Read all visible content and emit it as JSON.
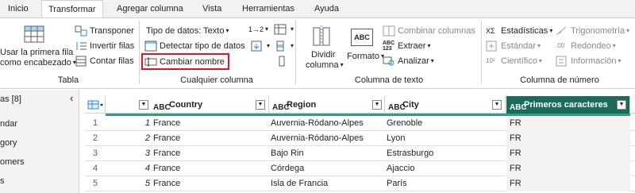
{
  "tabs": [
    "Inicio",
    "Transformar",
    "Agregar columna",
    "Vista",
    "Herramientas",
    "Ayuda"
  ],
  "active_tab": "Transformar",
  "ribbon": {
    "tabla": {
      "label": "Tabla",
      "use_first_row_line1": "Usar la primera fila",
      "use_first_row_line2": "como encabezado",
      "transpose": "Transponer",
      "reverse_rows": "Invertir filas",
      "count_rows": "Contar filas"
    },
    "any_column": {
      "label": "Cualquier columna",
      "data_type": "Tipo de datos: Texto",
      "detect_type": "Detectar tipo de datos",
      "rename": "Cambiar nombre",
      "replace_values_icon": "1→2"
    },
    "text_column": {
      "label": "Columna de texto",
      "split_line1": "Dividir",
      "split_line2": "columna",
      "format": "Formato",
      "merge_columns": "Combinar columnas",
      "extract": "Extraer",
      "analyze": "Analizar",
      "abc_icon": "ABC",
      "abc123_icon_line1": "ABC",
      "abc123_icon_line2": "123"
    },
    "number_column": {
      "label": "Columna de número",
      "statistics": "Estadísticas",
      "standard": "Estándar",
      "scientific": "Científico",
      "trigonometry": "Trigonometría",
      "rounding": "Redondeo",
      "information": "Información",
      "sigma_icon": "XΣ",
      "sci_icon": "10²",
      "round_icon": ".00"
    }
  },
  "left_pane": {
    "title": "as [8]",
    "items": [
      "ndar",
      "gory",
      "omers",
      "s"
    ]
  },
  "grid": {
    "type_icon": "ABC",
    "columns": [
      {
        "name": "Country"
      },
      {
        "name": "Region"
      },
      {
        "name": "City"
      },
      {
        "name": "Primeros caracteres"
      }
    ],
    "rows": [
      {
        "n": "1",
        "idx": "1",
        "country": "France",
        "region": "Auvernia-Ródano-Alpes",
        "city": "Grenoble",
        "first": "FR"
      },
      {
        "n": "2",
        "idx": "2",
        "country": "France",
        "region": "Auvernia-Ródano-Alpes",
        "city": "Lyon",
        "first": "FR"
      },
      {
        "n": "3",
        "idx": "3",
        "country": "France",
        "region": "Bajo Rin",
        "city": "Estrasburgo",
        "first": "FR"
      },
      {
        "n": "4",
        "idx": "4",
        "country": "France",
        "region": "Córdega",
        "city": "Ajaccio",
        "first": "FR"
      },
      {
        "n": "5",
        "idx": "5",
        "country": "France",
        "region": "Isla de Francia",
        "city": "París",
        "first": "FR"
      }
    ]
  },
  "colors": {
    "selected_header": "#1b6b5a",
    "quality_bar": "#2e9e85",
    "highlight_border": "#e81123"
  }
}
